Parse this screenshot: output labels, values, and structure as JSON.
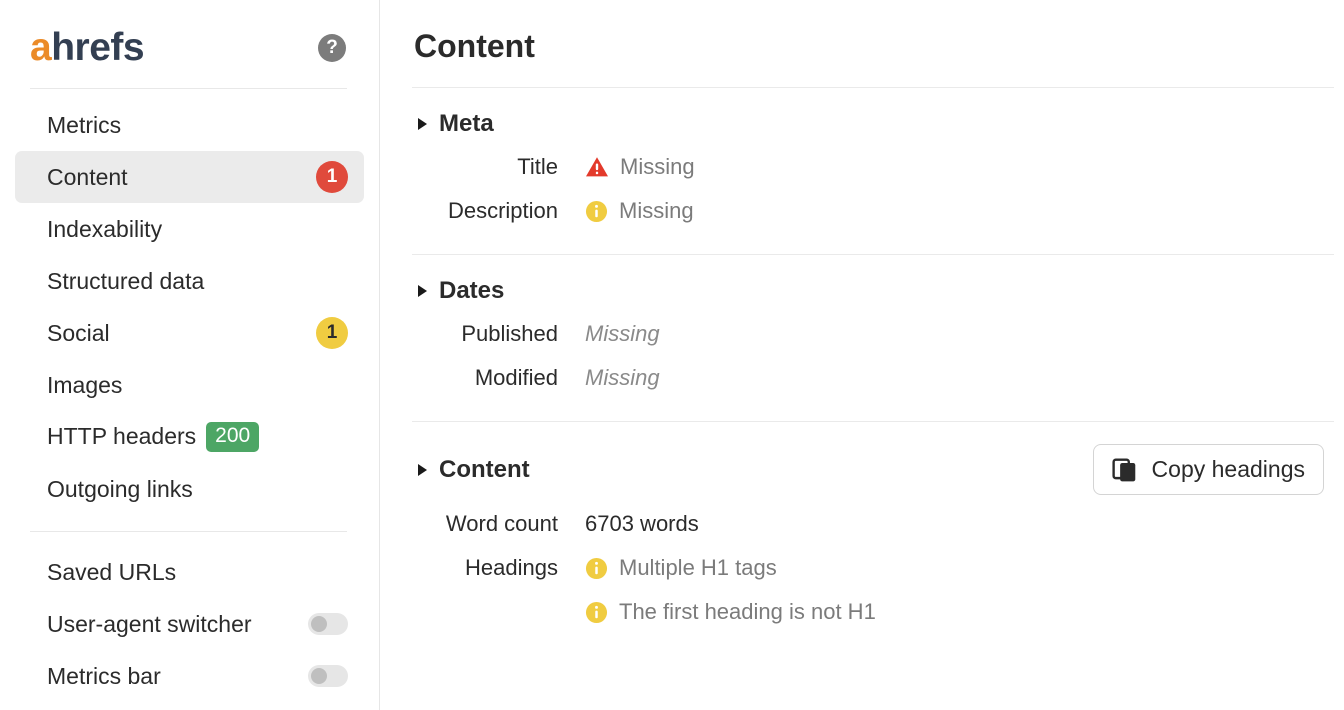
{
  "sidebar": {
    "logo": {
      "first_letter": "a",
      "rest": "hrefs"
    },
    "help_icon_label": "?",
    "nav_items": [
      {
        "label": "Metrics",
        "badge": null,
        "badge_type": "none",
        "active": false
      },
      {
        "label": "Content",
        "badge": "1",
        "badge_type": "red",
        "active": true
      },
      {
        "label": "Indexability",
        "badge": null,
        "badge_type": "none",
        "active": false
      },
      {
        "label": "Structured data",
        "badge": null,
        "badge_type": "none",
        "active": false
      },
      {
        "label": "Social",
        "badge": "1",
        "badge_type": "yellow",
        "active": false
      },
      {
        "label": "Images",
        "badge": null,
        "badge_type": "none",
        "active": false
      },
      {
        "label": "HTTP headers",
        "badge": "200",
        "badge_type": "green-pill",
        "active": false
      },
      {
        "label": "Outgoing links",
        "badge": null,
        "badge_type": "none",
        "active": false
      }
    ],
    "settings_items": [
      {
        "label": "Saved URLs",
        "toggle": false,
        "has_toggle": false
      },
      {
        "label": "User-agent switcher",
        "toggle": false,
        "has_toggle": true
      },
      {
        "label": "Metrics bar",
        "toggle": false,
        "has_toggle": true
      }
    ]
  },
  "main": {
    "page_title": "Content",
    "sections": [
      {
        "title": "Meta",
        "rows": [
          {
            "label": "Title",
            "value": "Missing",
            "icon": "warning-icon",
            "style": "muted"
          },
          {
            "label": "Description",
            "value": "Missing",
            "icon": "info-icon",
            "style": "muted"
          }
        ]
      },
      {
        "title": "Dates",
        "rows": [
          {
            "label": "Published",
            "value": "Missing",
            "icon": "none",
            "style": "italic"
          },
          {
            "label": "Modified",
            "value": "Missing",
            "icon": "none",
            "style": "italic"
          }
        ]
      },
      {
        "title": "Content",
        "action_button": {
          "label": "Copy headings",
          "icon": "copy-icon"
        },
        "rows": [
          {
            "label": "Word count",
            "value": "6703 words",
            "icon": "none",
            "style": "normal"
          },
          {
            "label": "Headings",
            "value": "Multiple H1 tags",
            "icon": "info-icon",
            "style": "muted"
          },
          {
            "label": "",
            "value": "The first heading is not H1",
            "icon": "info-icon",
            "style": "muted"
          }
        ]
      }
    ]
  },
  "colors": {
    "brand_orange": "#eb8b28",
    "brand_navy": "#333f52",
    "badge_red": "#e04a3c",
    "badge_yellow": "#f0cc41",
    "badge_green": "#4da665",
    "muted_text": "#7b7b7b"
  }
}
